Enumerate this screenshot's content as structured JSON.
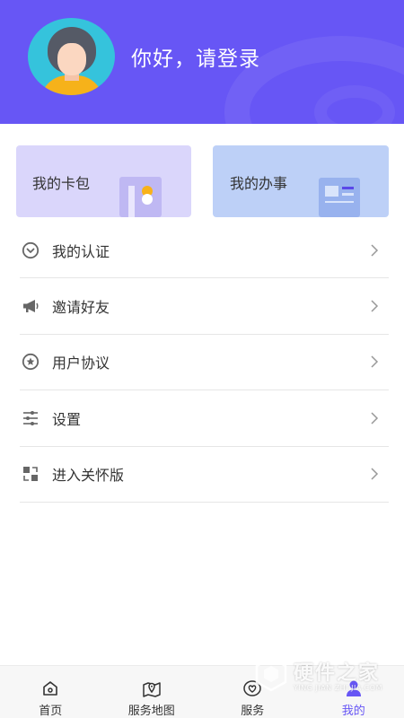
{
  "header": {
    "login_prompt": "你好，请登录",
    "background_color": "#6756f5",
    "avatar_icon": "user-avatar"
  },
  "cards": {
    "wallet": {
      "label": "我的卡包",
      "background": "#dad6fb",
      "icon": "card-wallet-icon"
    },
    "affairs": {
      "label": "我的办事",
      "background": "#bdd0f7",
      "icon": "id-card-icon"
    }
  },
  "menu": {
    "items": [
      {
        "label": "我的认证",
        "icon": "verified-shield-icon"
      },
      {
        "label": "邀请好友",
        "icon": "megaphone-icon"
      },
      {
        "label": "用户协议",
        "icon": "star-badge-icon"
      },
      {
        "label": "设置",
        "icon": "sliders-icon"
      },
      {
        "label": "进入关怀版",
        "icon": "expand-arrows-icon"
      }
    ],
    "chevron_icon": "chevron-right-icon"
  },
  "tabbar": {
    "active_color": "#6756f5",
    "tabs": [
      {
        "label": "首页",
        "icon": "home-icon"
      },
      {
        "label": "服务地图",
        "icon": "map-pin-icon"
      },
      {
        "label": "服务",
        "icon": "heart-service-icon"
      },
      {
        "label": "我的",
        "icon": "profile-icon",
        "active": true
      }
    ]
  },
  "watermark": {
    "title": "硬件之家",
    "subtitle": "YING JIAN ZHI JIA.COM"
  }
}
